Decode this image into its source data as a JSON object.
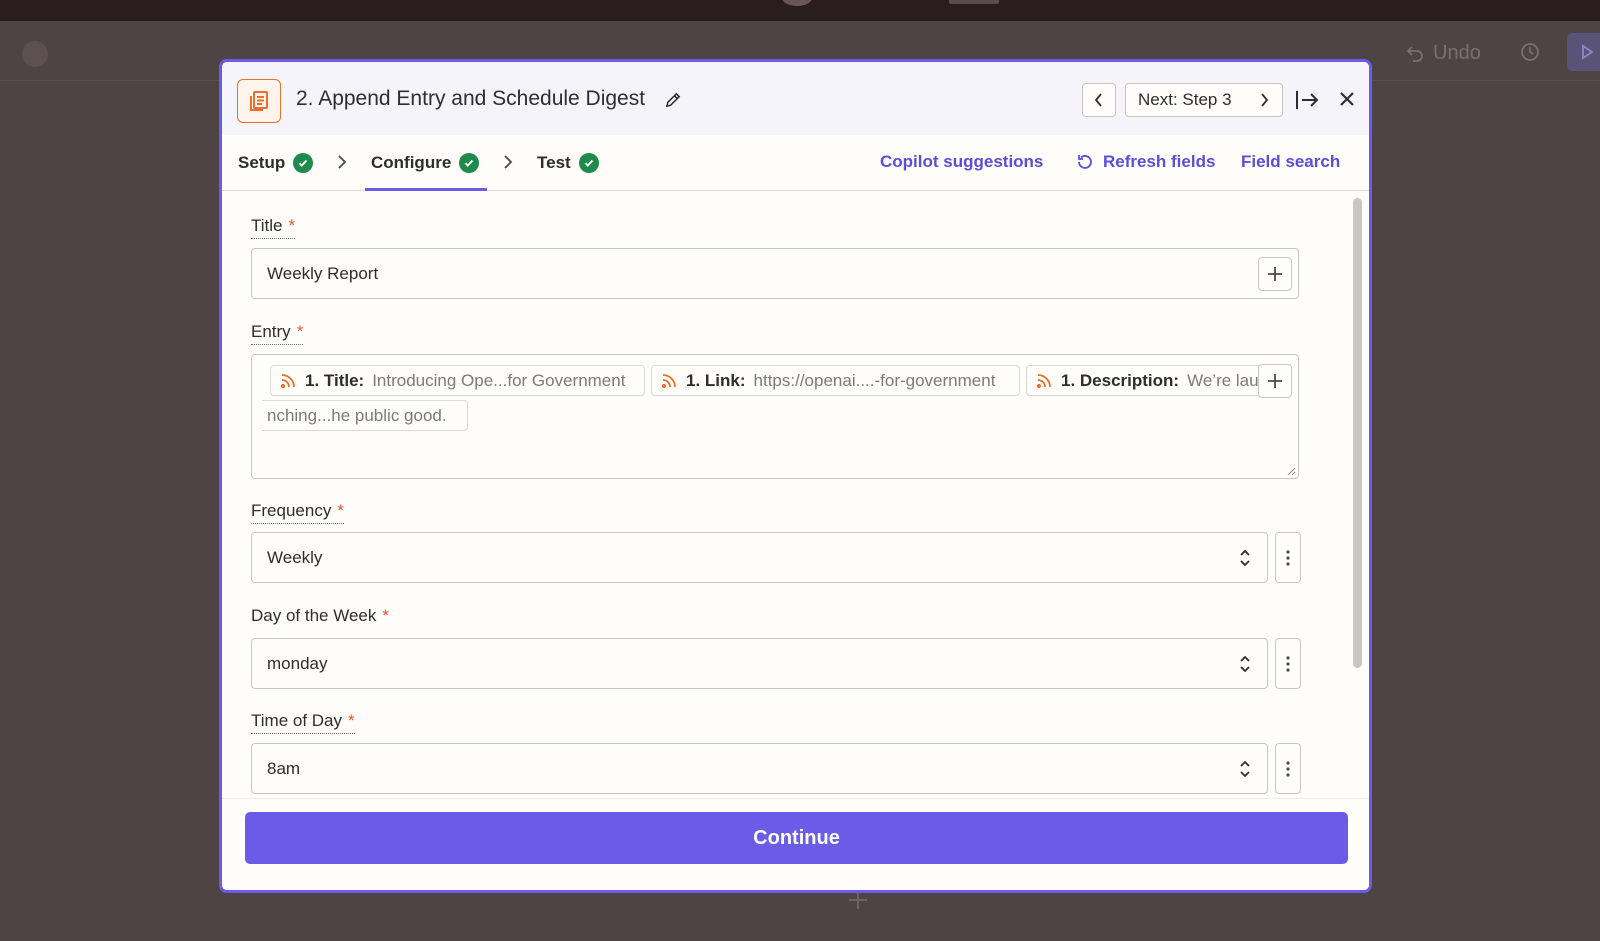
{
  "backdrop": {
    "undo_label": "Undo"
  },
  "modal": {
    "title": "2. Append Entry and Schedule Digest",
    "next_label": "Next: Step 3",
    "icons": {
      "app": "digest-app-icon",
      "edit": "pencil-icon",
      "prev": "chevron-left-icon",
      "next": "chevron-right-icon",
      "detach": "arrow-right-to-bar-icon",
      "close": "close-icon"
    }
  },
  "tabs": [
    {
      "label": "Setup",
      "complete": true,
      "active": false
    },
    {
      "label": "Configure",
      "complete": true,
      "active": true
    },
    {
      "label": "Test",
      "complete": true,
      "active": false
    }
  ],
  "actions": {
    "copilot": "Copilot suggestions",
    "refresh": "Refresh fields",
    "field_search": "Field search"
  },
  "fields": {
    "title": {
      "label": "Title",
      "required": "*",
      "value": "Weekly Report"
    },
    "entry": {
      "label": "Entry",
      "required": "*",
      "pills": [
        {
          "key": "1. Title:",
          "value": "Introducing Ope...for Government"
        },
        {
          "key": "1. Link:",
          "value": "https://openai....-for-government"
        },
        {
          "key": "1. Description:",
          "value": "We’re lau"
        }
      ],
      "wrap_text": "nching...he public good."
    },
    "frequency": {
      "label": "Frequency",
      "required": "*",
      "value": "Weekly"
    },
    "day_of_week": {
      "label": "Day of the Week",
      "required": "*",
      "value": "monday"
    },
    "time_of_day": {
      "label": "Time of Day",
      "required": "*",
      "value": "8am"
    }
  },
  "footer": {
    "continue_label": "Continue"
  },
  "colors": {
    "accent": "#6b5ce7",
    "link": "#5a4fd6",
    "success": "#1e8a4b",
    "required": "#e5572a",
    "app_icon": "#e8702a",
    "backdrop": "#4f4444"
  }
}
